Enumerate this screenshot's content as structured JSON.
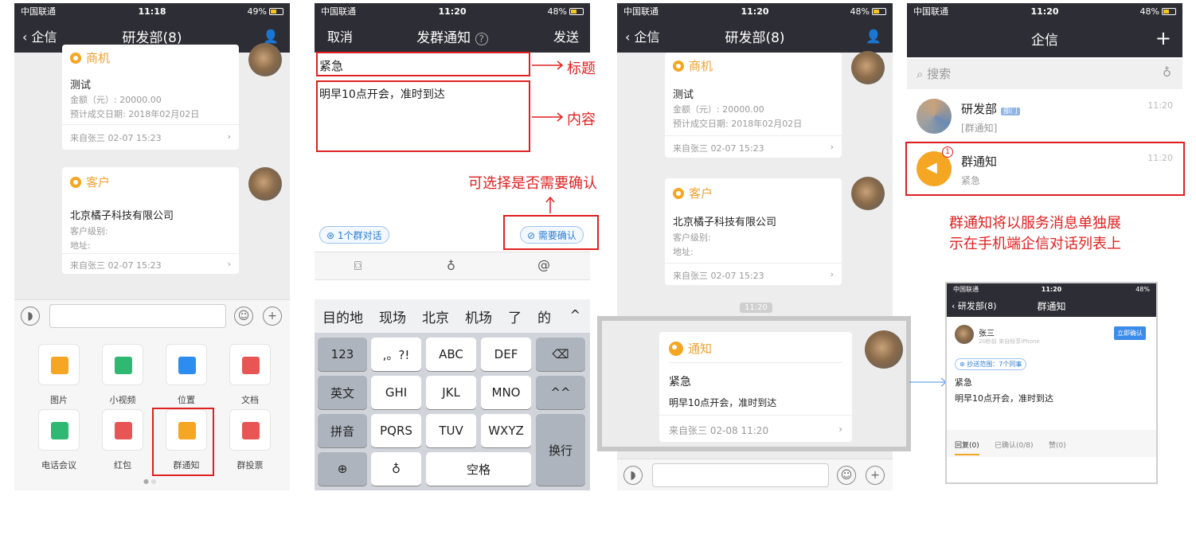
{
  "colors": {
    "navbar": "#2d2d35",
    "accent_orange": "#f5a623",
    "annotation_red": "#e02020",
    "link_blue": "#4a90e2"
  },
  "p1": {
    "status": {
      "carrier": "中国联通",
      "time": "11:18",
      "battery": "49%"
    },
    "nav": {
      "back": "企信",
      "title": "研发部(8)"
    },
    "card1": {
      "title": "商机",
      "main": "测试",
      "amount": "金额（元）: 20000.00",
      "date": "预计成交日期: 2018年02月02日",
      "from": "来自张三 02-07 15:23"
    },
    "card2": {
      "title": "客户",
      "main": "北京橘子科技有限公司",
      "level": "客户级别:",
      "addr": "地址:",
      "from": "来自张三 02-07 15:23"
    },
    "tools": [
      {
        "label": "图片",
        "icon": "image-icon",
        "color": "#f5a623"
      },
      {
        "label": "小视频",
        "icon": "video-icon",
        "color": "#2eb872"
      },
      {
        "label": "位置",
        "icon": "location-icon",
        "color": "#2d8cf0"
      },
      {
        "label": "文档",
        "icon": "document-icon",
        "color": "#e85555"
      },
      {
        "label": "电话会议",
        "icon": "phone-icon",
        "color": "#2eb872"
      },
      {
        "label": "红包",
        "icon": "red-packet-icon",
        "color": "#e85555"
      },
      {
        "label": "群通知",
        "icon": "group-notice-icon",
        "color": "#f5a623"
      },
      {
        "label": "群投票",
        "icon": "vote-icon",
        "color": "#e85555"
      }
    ]
  },
  "p2": {
    "status": {
      "carrier": "中国联通",
      "time": "11:20",
      "battery": "48%"
    },
    "nav": {
      "cancel": "取消",
      "title": "发群通知",
      "send": "发送"
    },
    "title_value": "紧急",
    "content_value": "明早10点开会，准时到达",
    "annot_title": "标题",
    "annot_content": "内容",
    "annot_confirm": "可选择是否需要确认",
    "group_chip": "1个群对话",
    "confirm_chip": "需要确认",
    "suggestions": [
      "目的地",
      "现场",
      "北京",
      "机场",
      "了",
      "的"
    ],
    "keys": {
      "k123": "123",
      "punct": ",。?!",
      "abc": "ABC",
      "def": "DEF",
      "en": "英文",
      "ghi": "GHI",
      "jkl": "JKL",
      "mno": "MNO",
      "face": "^^",
      "pinyin": "拼音",
      "pqrs": "PQRS",
      "tuv": "TUV",
      "wxyz": "WXYZ",
      "enter": "换行",
      "space": "空格"
    }
  },
  "p3": {
    "status": {
      "carrier": "中国联通",
      "time": "11:20",
      "battery": "48%"
    },
    "nav": {
      "back": "企信",
      "title": "研发部(8)"
    },
    "card1": {
      "title": "商机",
      "main": "测试",
      "amount": "金额（元）: 20000.00",
      "date": "预计成交日期: 2018年02月02日",
      "from": "来自张三 02-07 15:23"
    },
    "card2": {
      "title": "客户",
      "main": "北京橘子科技有限公司",
      "level": "客户级别:",
      "addr": "地址:",
      "from": "来自张三 02-07 15:23"
    },
    "time_chip": "11:20",
    "notice": {
      "title": "通知",
      "heading": "紧急",
      "body": "明早10点开会，准时到达",
      "from": "来自张三 02-08 11:20"
    }
  },
  "p4": {
    "status": {
      "carrier": "中国联通",
      "time": "11:20",
      "battery": "48%"
    },
    "nav": {
      "title": "企信"
    },
    "search_placeholder": "搜索",
    "chat1": {
      "name": "研发部",
      "tag": "部门",
      "sub": "[群通知]",
      "time": "11:20"
    },
    "chat2": {
      "name": "群通知",
      "sub": "紧急",
      "time": "11:20",
      "badge": "1"
    },
    "annot": [
      "群通知将以服务消息单独展",
      "示在手机端企信对话列表上"
    ]
  },
  "p5": {
    "status": {
      "carrier": "中国联通",
      "time": "11:20",
      "battery": "48%"
    },
    "nav": {
      "back": "研发部(8)",
      "title": "群通知"
    },
    "sender": "张三",
    "sender_meta": "20秒前  来自纷享iPhone",
    "confirm_btn": "立即确认",
    "scope": "抄送范围：7个同事",
    "heading": "紧急",
    "body": "明早10点开会，准时到达",
    "tabs": [
      "回复(0)",
      "已确认(0/8)",
      "赞(0)"
    ]
  }
}
